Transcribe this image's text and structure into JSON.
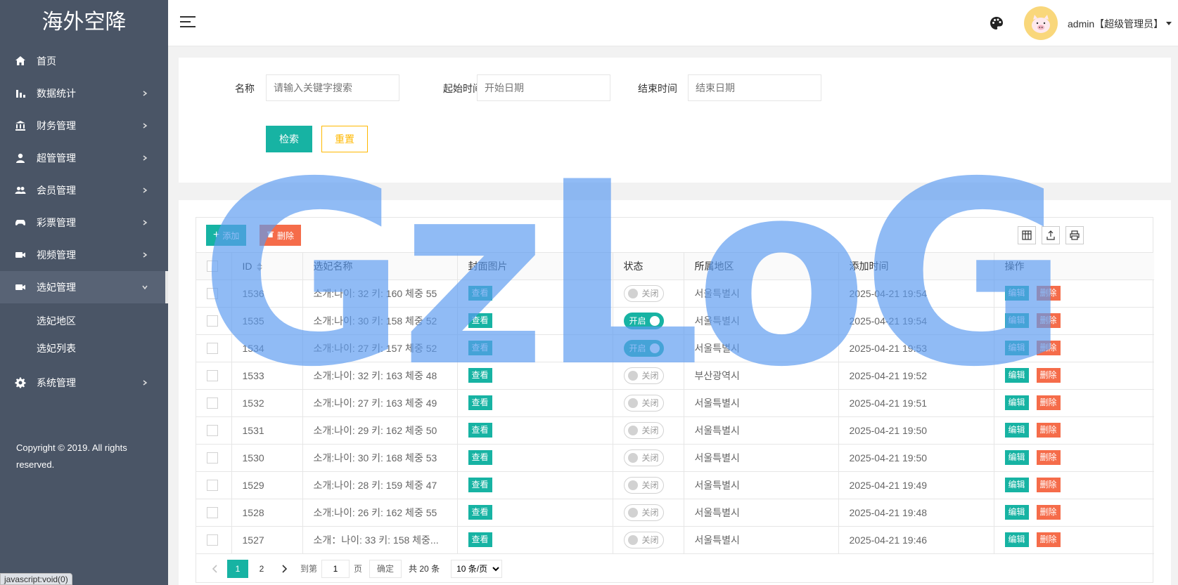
{
  "sidebar": {
    "logo": "海外空降",
    "items": [
      {
        "label": "首页",
        "icon": "home-icon"
      },
      {
        "label": "数据统计",
        "icon": "bar-chart-icon"
      },
      {
        "label": "财务管理",
        "icon": "bank-icon"
      },
      {
        "label": "超管管理",
        "icon": "user-icon"
      },
      {
        "label": "会员管理",
        "icon": "users-icon"
      },
      {
        "label": "彩票管理",
        "icon": "gamepad-icon"
      },
      {
        "label": "视频管理",
        "icon": "video-icon"
      },
      {
        "label": "选妃管理",
        "icon": "video-icon"
      },
      {
        "label": "系统管理",
        "icon": "gear-icon"
      }
    ],
    "submenu": [
      "选妃地区",
      "选妃列表"
    ],
    "copyright": "Copyright © 2019. All rights reserved.",
    "status_url": "javascript:void(0)"
  },
  "header": {
    "user": "admin【超级管理员】"
  },
  "search": {
    "name_label": "名称",
    "name_placeholder": "请输入关键字搜索",
    "start_label": "起始时间",
    "start_placeholder": "开始日期",
    "end_label": "结束时间",
    "end_placeholder": "结束日期",
    "search_btn": "检索",
    "reset_btn": "重置"
  },
  "toolbar": {
    "add_btn": "添加",
    "delete_btn": "删除"
  },
  "table": {
    "columns": [
      "ID",
      "选妃名称",
      "封面图片",
      "状态",
      "所属地区",
      "添加时间",
      "操作"
    ],
    "view_label": "查看",
    "edit_label": "编辑",
    "delete_label": "删除",
    "rows": [
      {
        "id": "1536",
        "name": "소개:나이: 32 키: 160 체중 55",
        "status": "关闭",
        "on": false,
        "region": "서울특별시",
        "time": "2025-04-21 19:54"
      },
      {
        "id": "1535",
        "name": "소개:나이: 30 키: 158 체중 52",
        "status": "开启",
        "on": true,
        "region": "서울특별시",
        "time": "2025-04-21 19:54"
      },
      {
        "id": "1534",
        "name": "소개:나이: 27 키: 157 체중 52",
        "status": "开启",
        "on": true,
        "region": "서울특별시",
        "time": "2025-04-21 19:53"
      },
      {
        "id": "1533",
        "name": "소개:나이: 32 키: 163 체중 48",
        "status": "关闭",
        "on": false,
        "region": "부산광역시",
        "time": "2025-04-21 19:52"
      },
      {
        "id": "1532",
        "name": "소개:나이: 27 키: 163 체중 49",
        "status": "关闭",
        "on": false,
        "region": "서울특별시",
        "time": "2025-04-21 19:51"
      },
      {
        "id": "1531",
        "name": "소개:나이: 29 키: 162 체중 50",
        "status": "关闭",
        "on": false,
        "region": "서울특별시",
        "time": "2025-04-21 19:50"
      },
      {
        "id": "1530",
        "name": "소개:나이: 30 키: 168 체중 53",
        "status": "关闭",
        "on": false,
        "region": "서울특별시",
        "time": "2025-04-21 19:50"
      },
      {
        "id": "1529",
        "name": "소개:나이: 28 키: 159 체중 47",
        "status": "关闭",
        "on": false,
        "region": "서울특별시",
        "time": "2025-04-21 19:49"
      },
      {
        "id": "1528",
        "name": "소개:나이: 26 키: 162 체중 55",
        "status": "关闭",
        "on": false,
        "region": "서울특별시",
        "time": "2025-04-21 19:48"
      },
      {
        "id": "1527",
        "name": "소개：나이: 33 키: 158 체중...",
        "status": "关闭",
        "on": false,
        "region": "서울특별시",
        "time": "2025-04-21 19:46"
      }
    ]
  },
  "pager": {
    "pages": [
      "1",
      "2"
    ],
    "goto_label": "到第",
    "page_value": "1",
    "page_unit": "页",
    "confirm": "确定",
    "total": "共 20 条",
    "size": "10 条/页"
  },
  "watermark": "GzLoG",
  "colors": {
    "primary": "#17b3a3",
    "danger": "#f56c4a",
    "warning": "#ffb800",
    "sidebar": "#4a5566"
  }
}
